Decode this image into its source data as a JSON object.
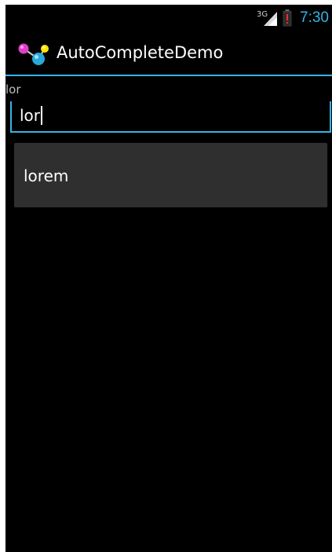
{
  "status_bar": {
    "network_type": "3G",
    "time": "7:30",
    "clock_color": "#33b5e5",
    "signal_icon": "signal-icon",
    "battery_icon": "battery-low-icon",
    "battery_alert_color": "#ff2b2b"
  },
  "action_bar": {
    "title": "AutoCompleteDemo",
    "icon": "app-molecule-icon",
    "underline_color": "#33b5e5"
  },
  "form": {
    "echo_text": "lor",
    "input_value": "lor",
    "accent_color": "#33b5e5"
  },
  "dropdown": {
    "suggestions": [
      "lorem"
    ]
  }
}
